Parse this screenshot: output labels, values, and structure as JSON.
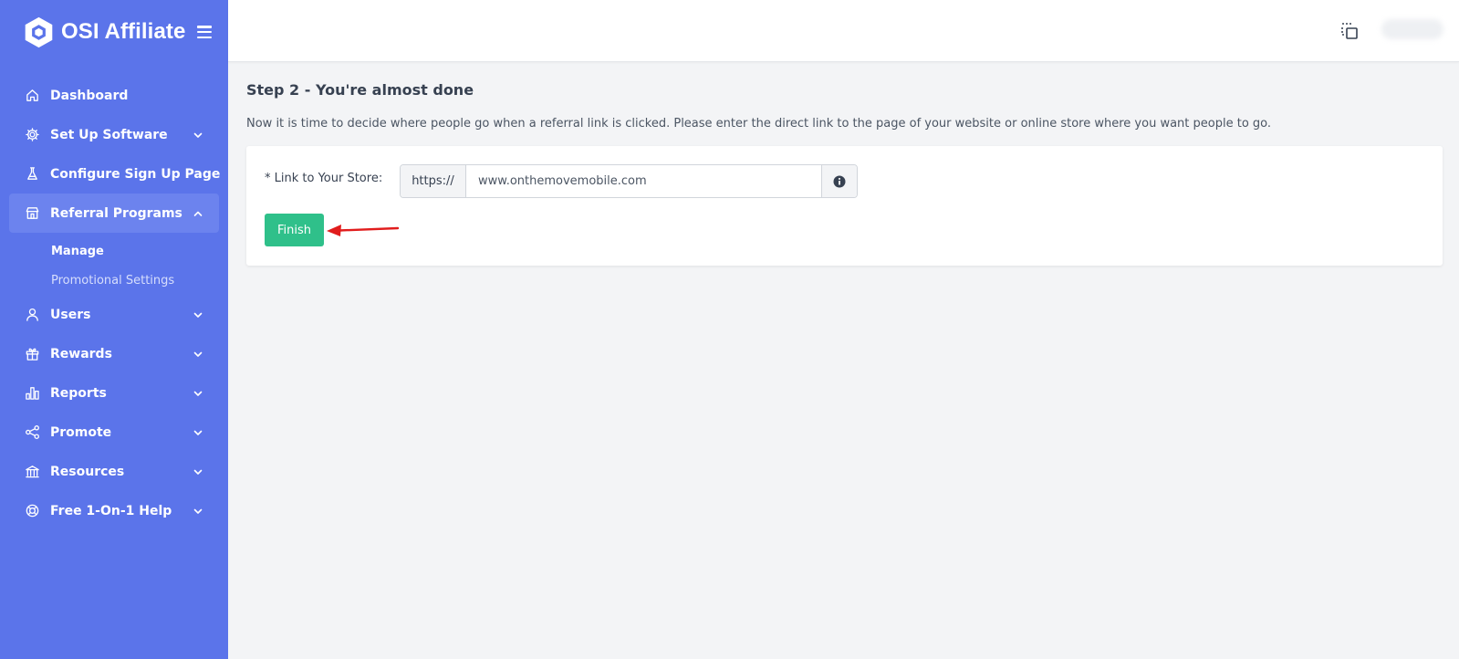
{
  "brand": {
    "name": "OSI Affiliate"
  },
  "sidebar": {
    "items": [
      {
        "label": "Dashboard",
        "icon": "home-icon",
        "has_chevron": false
      },
      {
        "label": "Set Up Software",
        "icon": "gear-icon",
        "has_chevron": true
      },
      {
        "label": "Configure Sign Up Page",
        "icon": "flask-icon",
        "has_chevron": false
      },
      {
        "label": "Referral Programs",
        "icon": "storefront-icon",
        "has_chevron": true,
        "expanded": true,
        "subitems": [
          {
            "label": "Manage",
            "current": true
          },
          {
            "label": "Promotional Settings",
            "current": false
          }
        ]
      },
      {
        "label": "Users",
        "icon": "user-icon",
        "has_chevron": true
      },
      {
        "label": "Rewards",
        "icon": "gift-icon",
        "has_chevron": true
      },
      {
        "label": "Reports",
        "icon": "bar-chart-icon",
        "has_chevron": true
      },
      {
        "label": "Promote",
        "icon": "share-icon",
        "has_chevron": true
      },
      {
        "label": "Resources",
        "icon": "bank-icon",
        "has_chevron": true
      },
      {
        "label": "Free 1-On-1 Help",
        "icon": "lifebuoy-icon",
        "has_chevron": true
      }
    ]
  },
  "main": {
    "title": "Step 2 - You're almost done",
    "description": "Now it is time to decide where people go when a referral link is clicked. Please enter the direct link to the page of your website or online store where you want people to go.",
    "form": {
      "label": "* Link to Your Store:",
      "prefix": "https://",
      "value": "www.onthemovemobile.com",
      "finish_label": "Finish"
    }
  },
  "colors": {
    "sidebar": "#5b74ea",
    "sidebar_active": "#6c83ee",
    "finish": "#2fc08a",
    "arrow": "#e11d1d"
  }
}
